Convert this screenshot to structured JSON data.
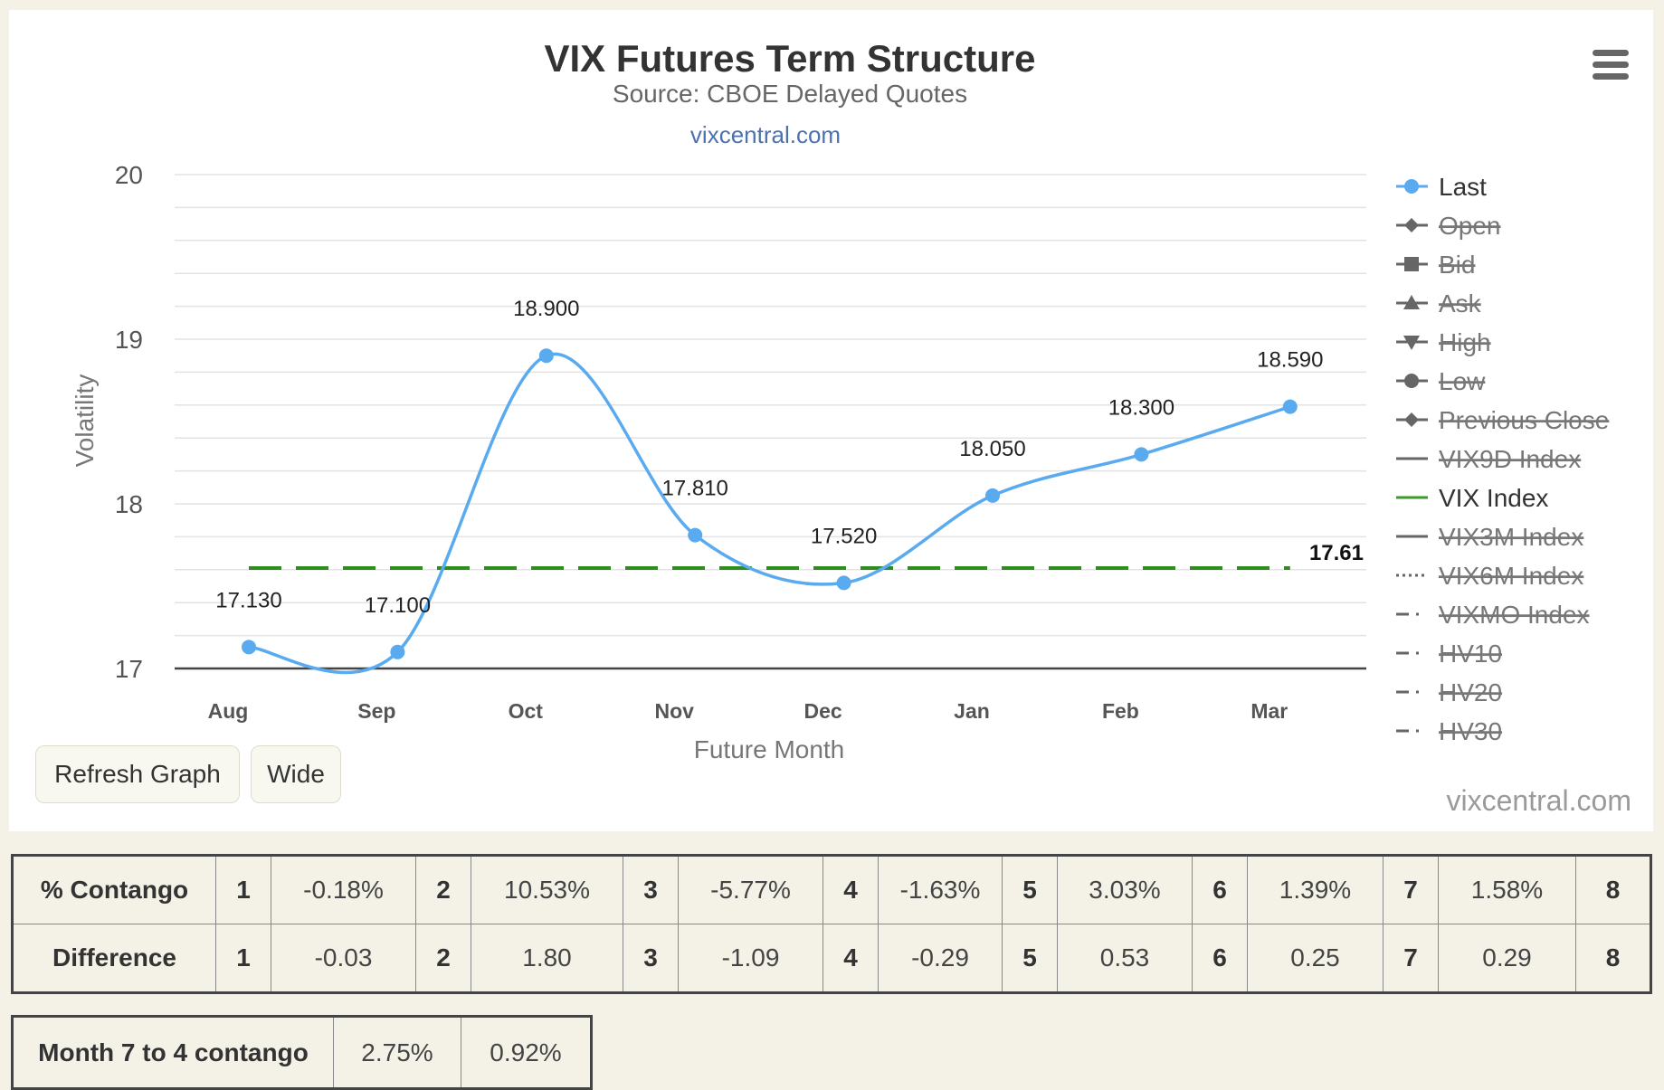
{
  "chart_data": {
    "type": "line",
    "title": "VIX Futures Term Structure",
    "subtitle": "Source: CBOE Delayed Quotes",
    "credit_link": "vixcentral.com",
    "xlabel": "Future Month",
    "ylabel": "Volatility",
    "categories": [
      "Aug",
      "Sep",
      "Oct",
      "Nov",
      "Dec",
      "Jan",
      "Feb",
      "Mar"
    ],
    "ylim": [
      17,
      20
    ],
    "yticks": [
      17,
      18,
      19,
      20
    ],
    "y_minor_step": 0.2,
    "grid": true,
    "legend_position": "right",
    "series": [
      {
        "name": "Last",
        "values": [
          17.13,
          17.1,
          18.9,
          17.81,
          17.52,
          18.05,
          18.3,
          18.59
        ],
        "data_labels": [
          "17.130",
          "17.100",
          "18.900",
          "17.810",
          "17.520",
          "18.050",
          "18.300",
          "18.590"
        ],
        "color": "#5aaaf0",
        "smooth": true,
        "visible": true
      },
      {
        "name": "VIX Index",
        "values": [
          17.61,
          17.61,
          17.61,
          17.61,
          17.61,
          17.61,
          17.61,
          17.61
        ],
        "end_label": "17.61",
        "color": "#2e8b1e",
        "dashed": true,
        "visible": true
      }
    ],
    "legend": [
      {
        "name": "Last",
        "symbol": "circle",
        "visible": true,
        "color": "#5aaaf0"
      },
      {
        "name": "Open",
        "symbol": "diamond",
        "visible": false
      },
      {
        "name": "Bid",
        "symbol": "square",
        "visible": false
      },
      {
        "name": "Ask",
        "symbol": "triangle",
        "visible": false
      },
      {
        "name": "High",
        "symbol": "triangle-down",
        "visible": false
      },
      {
        "name": "Low",
        "symbol": "circle",
        "visible": false
      },
      {
        "name": "Previous Close",
        "symbol": "diamond",
        "visible": false
      },
      {
        "name": "VIX9D Index",
        "symbol": "line",
        "visible": false
      },
      {
        "name": "VIX Index",
        "symbol": "line",
        "visible": true,
        "color": "#3a9a2a"
      },
      {
        "name": "VIX3M Index",
        "symbol": "line",
        "visible": false
      },
      {
        "name": "VIX6M Index",
        "symbol": "dotted",
        "visible": false
      },
      {
        "name": "VIXMO Index",
        "symbol": "dashdot",
        "visible": false
      },
      {
        "name": "HV10",
        "symbol": "dashdot",
        "visible": false
      },
      {
        "name": "HV20",
        "symbol": "dashdot",
        "visible": false
      },
      {
        "name": "HV30",
        "symbol": "dashdot",
        "visible": false
      }
    ],
    "watermark": "vixcentral.com"
  },
  "controls": {
    "menu_icon": "hamburger-menu-icon",
    "refresh_label": "Refresh Graph",
    "wide_label": "Wide"
  },
  "contango_table": {
    "rows": [
      {
        "label": "% Contango",
        "cells": [
          {
            "month": "1",
            "value": "-0.18%"
          },
          {
            "month": "2",
            "value": "10.53%"
          },
          {
            "month": "3",
            "value": "-5.77%"
          },
          {
            "month": "4",
            "value": "-1.63%"
          },
          {
            "month": "5",
            "value": "3.03%"
          },
          {
            "month": "6",
            "value": "1.39%"
          },
          {
            "month": "7",
            "value": "1.58%"
          }
        ],
        "last_month": "8"
      },
      {
        "label": "Difference",
        "cells": [
          {
            "month": "1",
            "value": "-0.03"
          },
          {
            "month": "2",
            "value": "1.80"
          },
          {
            "month": "3",
            "value": "-1.09"
          },
          {
            "month": "4",
            "value": "-0.29"
          },
          {
            "month": "5",
            "value": "0.53"
          },
          {
            "month": "6",
            "value": "0.25"
          },
          {
            "month": "7",
            "value": "0.29"
          }
        ],
        "last_month": "8"
      }
    ]
  },
  "month_table": {
    "label": "Month 7 to 4 contango",
    "values": [
      "2.75%",
      "0.92%"
    ]
  }
}
